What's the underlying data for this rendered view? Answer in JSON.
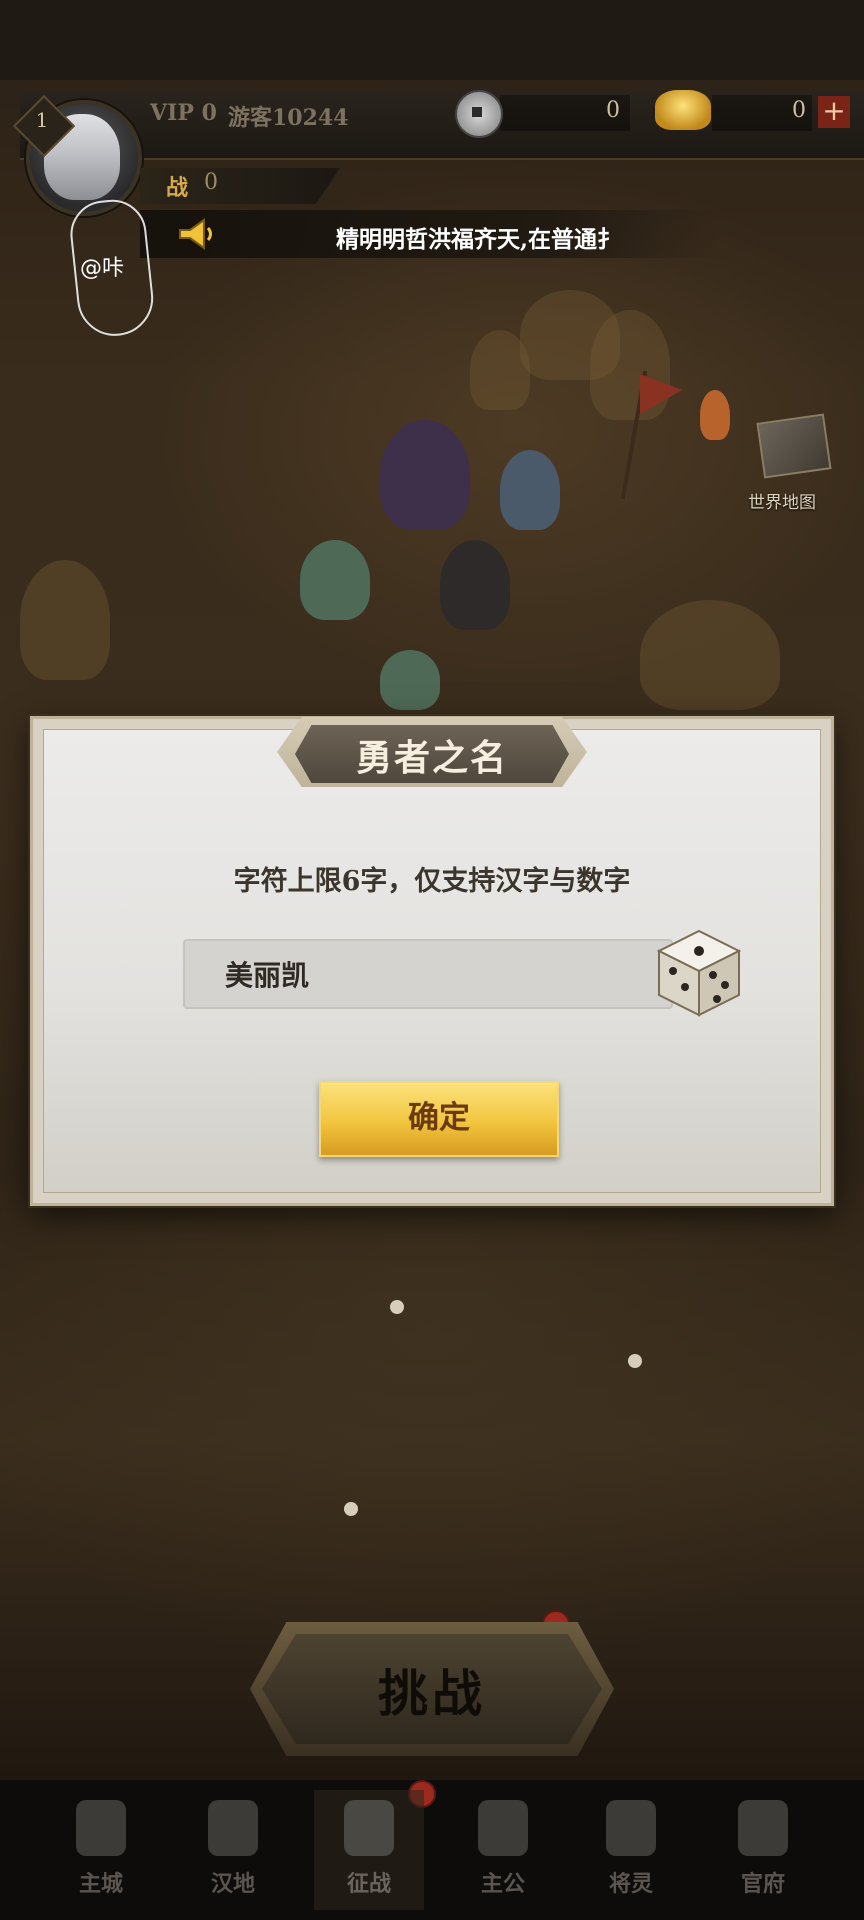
{
  "header": {
    "level": "1",
    "vip": "VIP 0",
    "player_name": "游客10244",
    "coin_value": "0",
    "ingot_value": "0",
    "plus_label": "+",
    "power_label": "战",
    "power_value": "0"
  },
  "marquee": {
    "text": "精明明哲洪福齐天,在普通扌"
  },
  "watermark": {
    "text": "@咔"
  },
  "map": {
    "world_map_label": "世界地图"
  },
  "dialog": {
    "title": "勇者之名",
    "hint": "字符上限6字，仅支持汉字与数字",
    "name_value": "美丽凯",
    "confirm_label": "确定"
  },
  "challenge": {
    "label": "挑战"
  },
  "nav": {
    "items": [
      {
        "label": "主城"
      },
      {
        "label": "汉地"
      },
      {
        "label": "征战"
      },
      {
        "label": "主公"
      },
      {
        "label": "将灵"
      },
      {
        "label": "官府"
      }
    ],
    "active_index": 2
  },
  "colors": {
    "accent_gold": "#f2c53e",
    "dialog_bg": "#ecebea",
    "title_bar": "#4f473c",
    "badge_red": "#9c2a1f"
  }
}
